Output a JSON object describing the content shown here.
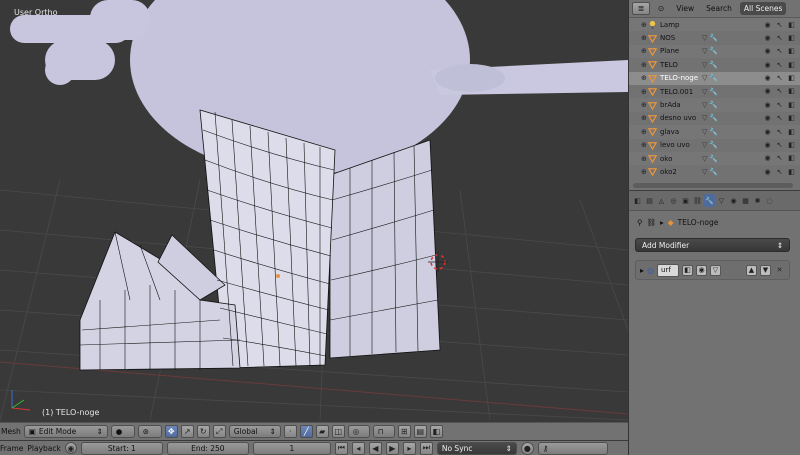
{
  "viewport": {
    "view_label": "User Ortho",
    "object_label": "(1) TELO-noge"
  },
  "header": {
    "editor_label": "Mesh",
    "mode": "Edit Mode",
    "orientation": "Global"
  },
  "timeline": {
    "frame_menu": "Frame",
    "playback_menu": "Playback",
    "start": "Start: 1",
    "end": "End: 250",
    "current": "1",
    "sync": "No Sync"
  },
  "outliner": {
    "tabs": [
      "View",
      "Search",
      "All Scenes"
    ],
    "items": [
      {
        "name": "Lamp",
        "type": "lamp"
      },
      {
        "name": "NOS",
        "type": "mesh"
      },
      {
        "name": "Plane",
        "type": "mesh"
      },
      {
        "name": "TELO",
        "type": "mesh"
      },
      {
        "name": "TELO-noge",
        "type": "mesh",
        "active": true
      },
      {
        "name": "TELO.001",
        "type": "mesh"
      },
      {
        "name": "brAda",
        "type": "mesh"
      },
      {
        "name": "desno uvo",
        "type": "mesh"
      },
      {
        "name": "glava",
        "type": "mesh"
      },
      {
        "name": "levo uvo",
        "type": "mesh"
      },
      {
        "name": "oko",
        "type": "mesh"
      },
      {
        "name": "oko2",
        "type": "mesh"
      }
    ]
  },
  "properties": {
    "context_object": "TELO-noge",
    "add_modifier": "Add Modifier",
    "modifier_name": "urf"
  },
  "colors": {
    "accent": "#4f6a9e",
    "mesh_orange": "#e8953a",
    "panel": "#727272",
    "viewport": "#393939"
  }
}
